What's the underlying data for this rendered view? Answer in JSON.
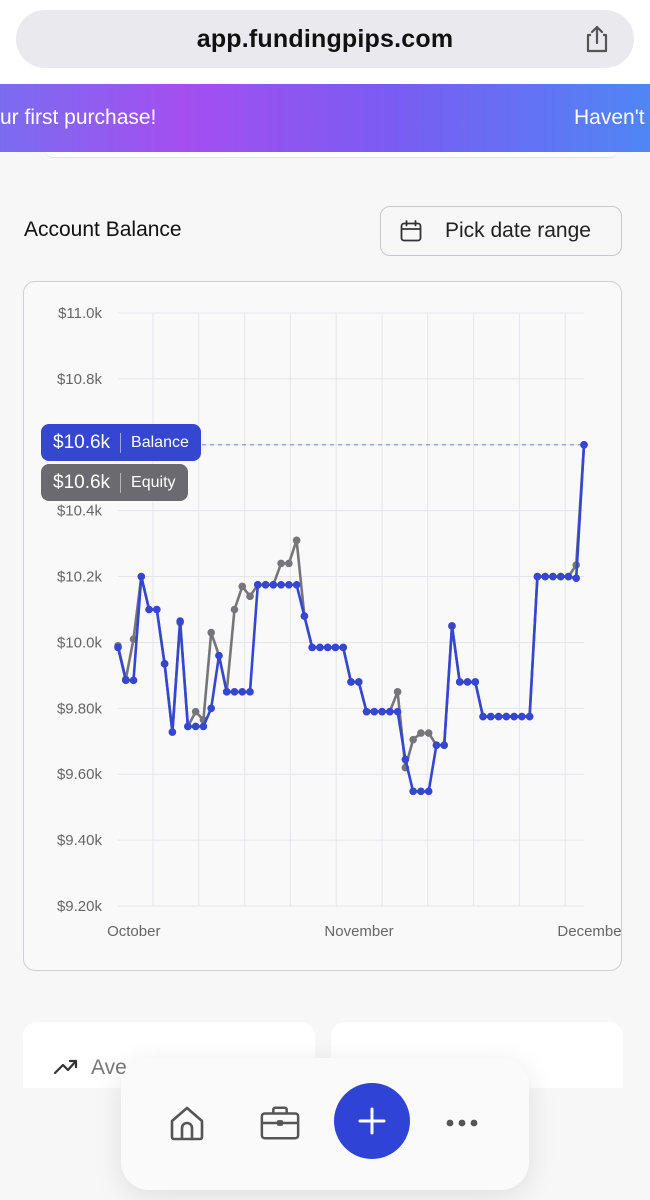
{
  "browser": {
    "url": "app.fundingpips.com",
    "share_icon": "share-icon"
  },
  "promo": {
    "text_left": "ur first purchase!",
    "text_right": "Haven't"
  },
  "section": {
    "title": "Account Balance",
    "date_button": "Pick date range",
    "calendar_icon": "calendar-icon"
  },
  "tooltip": {
    "balance_value": "$10.6k",
    "balance_label": "Balance",
    "equity_value": "$10.6k",
    "equity_label": "Equity"
  },
  "colors": {
    "balance": "#3546d0",
    "equity": "#75757a",
    "accent": "#2f43d4"
  },
  "chart_data": {
    "type": "line",
    "ylim": [
      9200,
      11000
    ],
    "y_ticks": [
      {
        "value": 11000,
        "label": "$11.0k"
      },
      {
        "value": 10800,
        "label": "$10.8k"
      },
      {
        "value": 10600,
        "label": "$10.6k"
      },
      {
        "value": 10400,
        "label": "$10.4k"
      },
      {
        "value": 10200,
        "label": "$10.2k"
      },
      {
        "value": 10000,
        "label": "$10.0k"
      },
      {
        "value": 9800,
        "label": "$9.80k"
      },
      {
        "value": 9600,
        "label": "$9.60k"
      },
      {
        "value": 9400,
        "label": "$9.40k"
      },
      {
        "value": 9200,
        "label": "$9.20k"
      }
    ],
    "x_labels": [
      {
        "index": 1,
        "label": "October"
      },
      {
        "index": 30,
        "label": "November"
      },
      {
        "index": 60,
        "label": "December"
      }
    ],
    "x_count": 73,
    "grid": true,
    "series": [
      {
        "name": "Equity",
        "values": [
          9990,
          9888,
          10010,
          10200,
          10100,
          10100,
          9935,
          9728,
          10060,
          9745,
          9790,
          9765,
          10030,
          9960,
          9850,
          10100,
          10170,
          10140,
          10175,
          10175,
          10175,
          10240,
          10240,
          10310,
          10080,
          9985,
          9985,
          9985,
          9985,
          9985,
          9880,
          9880,
          9790,
          9790,
          9790,
          9790,
          9850,
          9620,
          9705,
          9725,
          9725,
          9688,
          9688,
          10050,
          9880,
          9880,
          9880,
          9775,
          9775,
          9775,
          9775,
          9775,
          9775,
          9775,
          10200,
          10200,
          10200,
          10200,
          10200,
          10235,
          10600
        ]
      },
      {
        "name": "Balance",
        "values": [
          9985,
          9885,
          9885,
          10200,
          10100,
          10100,
          9935,
          9728,
          10065,
          9745,
          9745,
          9745,
          9800,
          9960,
          9850,
          9850,
          9850,
          9850,
          10175,
          10175,
          10175,
          10175,
          10175,
          10175,
          10080,
          9985,
          9985,
          9985,
          9985,
          9985,
          9880,
          9880,
          9790,
          9790,
          9790,
          9790,
          9790,
          9645,
          9548,
          9548,
          9548,
          9688,
          9688,
          10050,
          9880,
          9880,
          9880,
          9775,
          9775,
          9775,
          9775,
          9775,
          9775,
          9775,
          10200,
          10200,
          10200,
          10200,
          10200,
          10195,
          10600
        ]
      }
    ]
  },
  "stats": {
    "left_label": "Ave",
    "trend_icon": "trend-up-icon"
  },
  "nav": {
    "home_icon": "home-icon",
    "briefcase_icon": "briefcase-icon",
    "add_icon": "plus-icon",
    "more_icon": "more-icon"
  }
}
